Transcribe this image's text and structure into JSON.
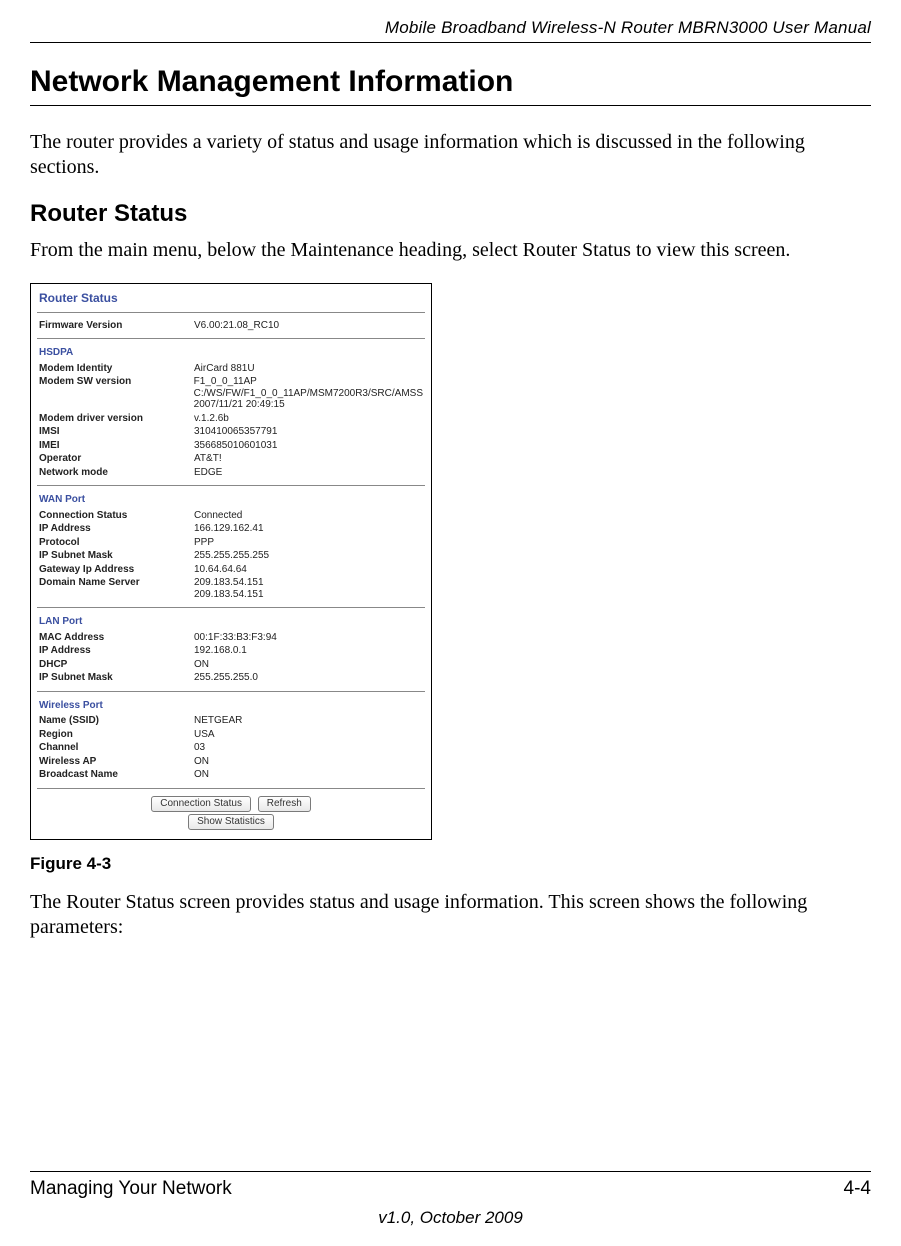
{
  "running_head": "Mobile Broadband Wireless-N Router MBRN3000 User Manual",
  "section_title": "Network Management Information",
  "intro_para": "The router provides a variety of status and usage information which is discussed in the following sections.",
  "sub_title": "Router Status",
  "sub_para": "From the main menu, below the Maintenance heading, select Router Status to view this screen.",
  "screenshot": {
    "title": "Router Status",
    "top_row": {
      "label": "Firmware Version",
      "value": "V6.00:21.08_RC10"
    },
    "groups": [
      {
        "name": "HSDPA",
        "rows": [
          {
            "label": "Modem Identity",
            "value": "AirCard 881U"
          },
          {
            "label": "Modem SW version",
            "value": "F1_0_0_11AP\nC:/WS/FW/F1_0_0_11AP/MSM7200R3/SRC/AMSS\n2007/11/21 20:49:15"
          },
          {
            "label": "Modem driver version",
            "value": "v.1.2.6b"
          },
          {
            "label": "IMSI",
            "value": "310410065357791"
          },
          {
            "label": "IMEI",
            "value": "356685010601031"
          },
          {
            "label": "Operator",
            "value": "AT&T!"
          },
          {
            "label": "Network mode",
            "value": "EDGE"
          }
        ]
      },
      {
        "name": "WAN Port",
        "rows": [
          {
            "label": "Connection Status",
            "value": "Connected"
          },
          {
            "label": "IP Address",
            "value": "166.129.162.41"
          },
          {
            "label": "Protocol",
            "value": "PPP"
          },
          {
            "label": "IP Subnet Mask",
            "value": "255.255.255.255"
          },
          {
            "label": "Gateway Ip Address",
            "value": "10.64.64.64"
          },
          {
            "label": "Domain Name Server",
            "value": "209.183.54.151\n209.183.54.151"
          }
        ]
      },
      {
        "name": "LAN Port",
        "rows": [
          {
            "label": "MAC Address",
            "value": "00:1F:33:B3:F3:94"
          },
          {
            "label": "IP Address",
            "value": "192.168.0.1"
          },
          {
            "label": "DHCP",
            "value": "ON"
          },
          {
            "label": "IP Subnet Mask",
            "value": "255.255.255.0"
          }
        ]
      },
      {
        "name": "Wireless Port",
        "rows": [
          {
            "label": "Name (SSID)",
            "value": "NETGEAR"
          },
          {
            "label": "Region",
            "value": "USA"
          },
          {
            "label": "Channel",
            "value": "03"
          },
          {
            "label": "Wireless AP",
            "value": "ON"
          },
          {
            "label": "Broadcast Name",
            "value": "ON"
          }
        ]
      }
    ],
    "buttons": {
      "conn": "Connection Status",
      "refresh": "Refresh",
      "stats": "Show Statistics"
    }
  },
  "figure_caption": "Figure 4-3",
  "after_para": "The Router Status screen provides status and usage information. This screen shows the following parameters:",
  "footer": {
    "left": "Managing Your Network",
    "right": "4-4",
    "center": "v1.0, October 2009"
  }
}
